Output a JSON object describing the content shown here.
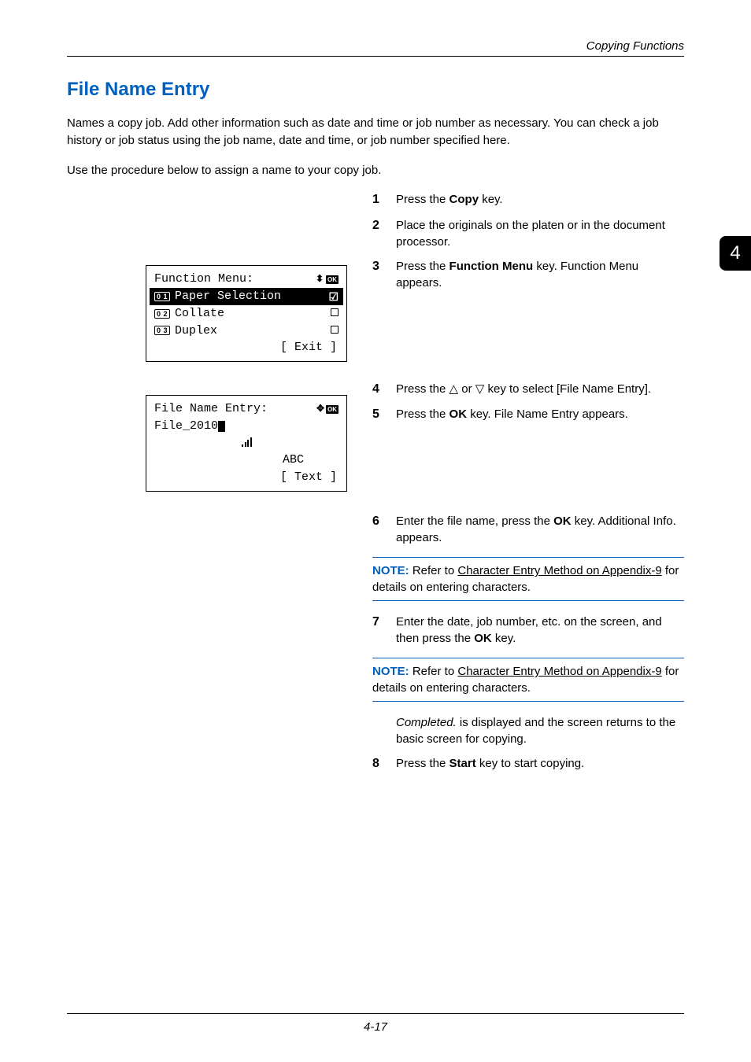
{
  "header": {
    "section": "Copying Functions"
  },
  "side_tab": "4",
  "title": "File Name Entry",
  "intro1": "Names a copy job. Add other information such as date and time or job number as necessary. You can check a job history or job status using the job name, date and time, or job number specified here.",
  "intro2": "Use the procedure below to assign a name to your copy job.",
  "lcd1": {
    "title": "Function Menu:",
    "items": [
      {
        "idx": "0 1",
        "label": "Paper Selection",
        "mark": "check",
        "selected": true
      },
      {
        "idx": "0 2",
        "label": "Collate",
        "mark": "square",
        "selected": false
      },
      {
        "idx": "0 3",
        "label": "Duplex",
        "mark": "square",
        "selected": false
      }
    ],
    "softkey": "[  Exit  ]"
  },
  "lcd2": {
    "title": "File Name Entry:",
    "value": "File_2010",
    "mode": "ABC",
    "softkey": "[  Text  ]"
  },
  "steps": {
    "s1": {
      "n": "1",
      "pre": "Press the ",
      "bold": "Copy",
      "post": " key."
    },
    "s2": {
      "n": "2",
      "text": "Place the originals on the platen or in the document processor."
    },
    "s3": {
      "n": "3",
      "pre": "Press the ",
      "bold": "Function Menu",
      "post": " key. Function Menu appears."
    },
    "s4": {
      "n": "4",
      "pre": "Press the ",
      "sym1": "△",
      "mid": " or ",
      "sym2": "▽",
      "post": " key to select [File Name Entry]."
    },
    "s5": {
      "n": "5",
      "pre": "Press the ",
      "bold": "OK",
      "post": " key. File Name Entry appears."
    },
    "s6": {
      "n": "6",
      "pre": "Enter the file name, press the ",
      "bold": "OK",
      "post": " key. Additional Info. appears."
    },
    "s7": {
      "n": "7",
      "pre": "Enter the date, job number, etc. on the screen, and then press the ",
      "bold": "OK",
      "post": " key."
    },
    "sC": {
      "ital": "Completed.",
      "post": " is displayed and the screen returns to the basic screen for copying."
    },
    "s8": {
      "n": "8",
      "pre": "Press the ",
      "bold": "Start",
      "post": " key to start copying."
    }
  },
  "note": {
    "label": "NOTE:",
    "pre": " Refer to ",
    "link": "Character Entry Method on Appendix-9",
    "post": " for details on entering characters."
  },
  "footer": "4-17"
}
